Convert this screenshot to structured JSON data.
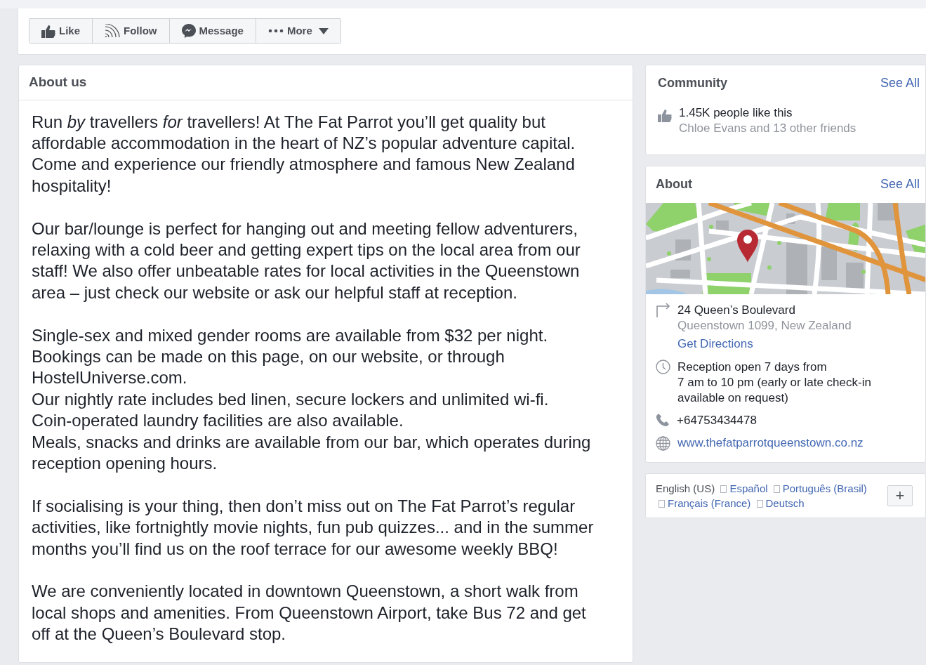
{
  "toolbar": {
    "buttons": [
      {
        "kind": "like",
        "label": "Like"
      },
      {
        "kind": "follow",
        "label": "Follow"
      },
      {
        "kind": "message",
        "label": "Message"
      },
      {
        "kind": "more",
        "label": "More"
      }
    ]
  },
  "about_us": {
    "title": "About us",
    "paragraphs": [
      {
        "lines": [
          "Run *by* travellers *for* travellers! At The Fat Parrot you’ll get quality but",
          "affordable accommodation in the heart of NZ’s popular adventure capital.",
          "Come and experience our friendly atmosphere and famous New Zealand",
          "hospitality!"
        ]
      },
      {
        "lines": [
          "Our bar/lounge is perfect for hanging out and meeting fellow adventurers,",
          "relaxing with a cold beer and getting expert tips on the local area from our",
          "staff! We also offer unbeatable rates for local activities in the Queenstown",
          "area – just check our website or ask our helpful staff at reception."
        ]
      },
      {
        "lines": [
          "Single-sex and mixed gender rooms are available from $32 per night.",
          "Bookings can be made on this page, on our website, or through",
          "HostelUniverse.com.",
          "Our nightly rate includes bed linen, secure lockers and unlimited wi-fi.",
          "Coin-operated laundry facilities are also available.",
          "Meals, snacks and drinks are available from our bar, which operates during",
          "reception opening hours."
        ]
      },
      {
        "lines": [
          "If socialising is your thing, then don’t miss out on The Fat Parrot’s regular",
          "activities, like fortnightly movie nights, fun pub quizzes... and in the summer",
          "months you’ll find us on the roof terrace for our awesome weekly BBQ!"
        ]
      },
      {
        "lines": [
          "We are conveniently located in downtown Queenstown, a short walk from",
          "local shops and amenities. From Queenstown Airport, take Bus 72 and get",
          "off at the Queen’s Boulevard stop."
        ]
      }
    ]
  },
  "community": {
    "title": "Community",
    "see_all": "See All",
    "likes": "1.45K people like this",
    "friends": "Chloe Evans and 13 other friends"
  },
  "about": {
    "title": "About",
    "see_all": "See All",
    "address": "24 Queen’s Boulevard",
    "city": "Queenstown 1099, New Zealand",
    "directions": "Get Directions",
    "hours": [
      "Reception open 7 days from",
      "7 am to 10 pm (early or late check-in",
      "available on request)"
    ],
    "phone": "+64753434478",
    "website": "www.thefatparrotqueenstown.co.nz"
  },
  "languages": {
    "current": "English (US)",
    "links": [
      "Español",
      "Português (Brasil)",
      "Français (France)",
      "Deutsch"
    ],
    "add": "+"
  }
}
